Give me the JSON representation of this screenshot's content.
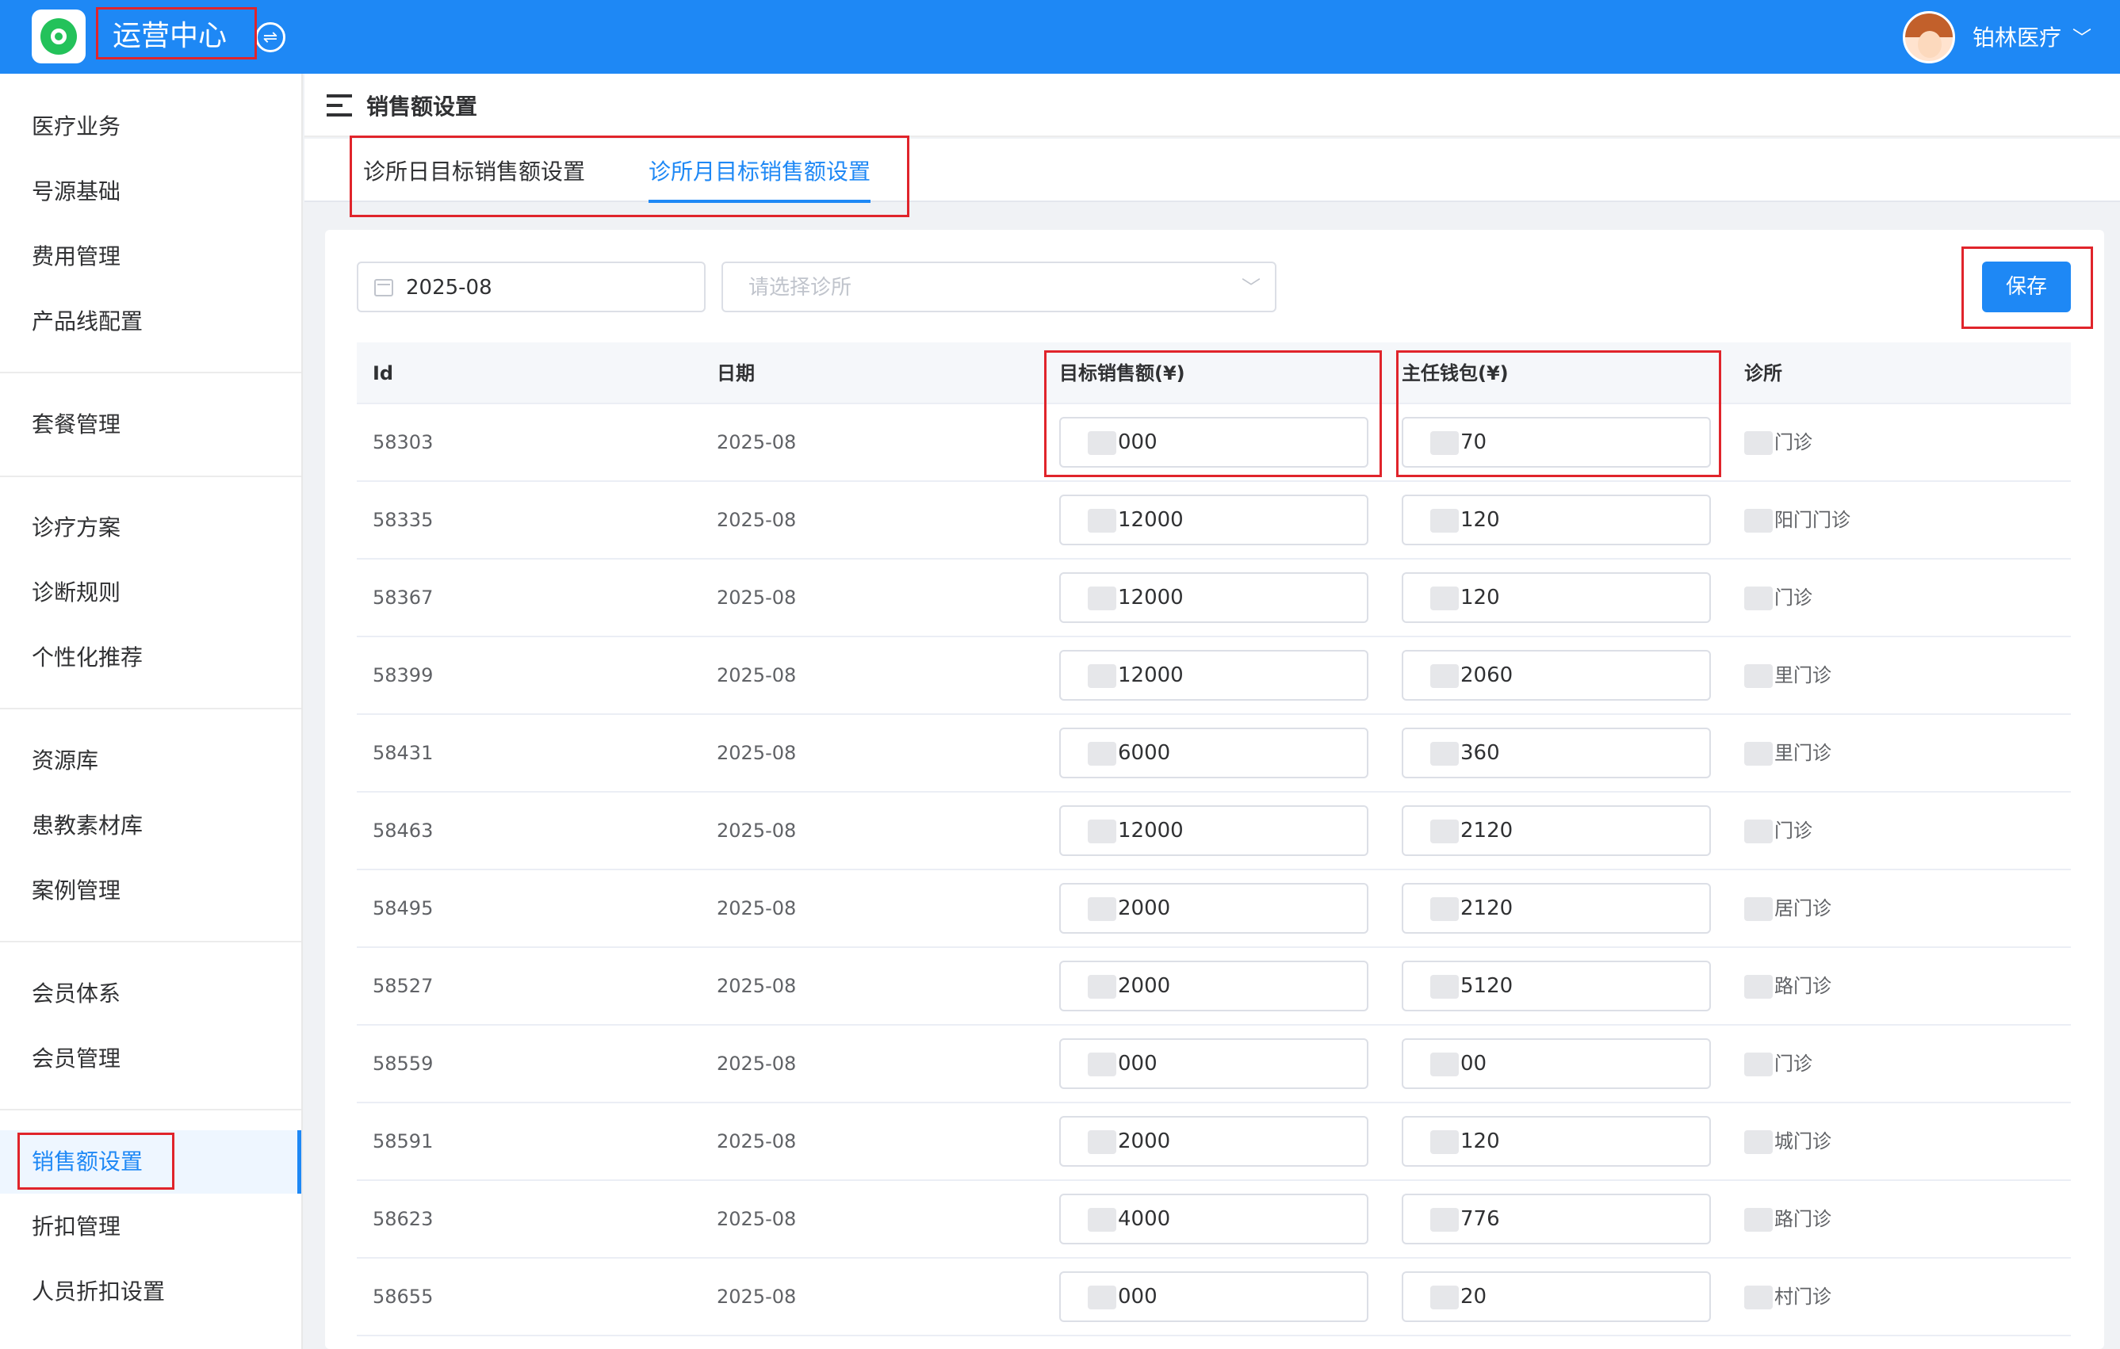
{
  "header": {
    "app_title": "运营中心",
    "user_name": "铂林医疗",
    "user_caret": "﹀",
    "brand_color": "#1e88f5"
  },
  "sidebar": {
    "items": [
      {
        "label": "医疗业务"
      },
      {
        "label": "号源基础"
      },
      {
        "label": "费用管理"
      },
      {
        "label": "产品线配置"
      },
      {
        "label": "套餐管理"
      },
      {
        "label": "诊疗方案"
      },
      {
        "label": "诊断规则"
      },
      {
        "label": "个性化推荐"
      },
      {
        "label": "资源库"
      },
      {
        "label": "患教素材库"
      },
      {
        "label": "案例管理"
      },
      {
        "label": "会员体系"
      },
      {
        "label": "会员管理"
      },
      {
        "label": "销售额设置",
        "active": true
      },
      {
        "label": "折扣管理"
      },
      {
        "label": "人员折扣设置"
      }
    ]
  },
  "page": {
    "title": "销售额设置"
  },
  "tabs": [
    {
      "label": "诊所日目标销售额设置",
      "active": false
    },
    {
      "label": "诊所月目标销售额设置",
      "active": true
    }
  ],
  "filters": {
    "month_value": "2025-08",
    "clinic_placeholder": "请选择诊所",
    "clinic_chevron": "﹀"
  },
  "actions": {
    "save_label": "保存"
  },
  "table": {
    "columns": [
      "Id",
      "日期",
      "目标销售额(¥)",
      "主任钱包(¥)",
      "诊所"
    ],
    "rows": [
      {
        "id": "58303",
        "date": "2025-08",
        "target": "000",
        "wallet": "70",
        "clinic": "门诊"
      },
      {
        "id": "58335",
        "date": "2025-08",
        "target": "12000",
        "wallet": "120",
        "clinic": "阳门门诊"
      },
      {
        "id": "58367",
        "date": "2025-08",
        "target": "12000",
        "wallet": "120",
        "clinic": "门诊"
      },
      {
        "id": "58399",
        "date": "2025-08",
        "target": "12000",
        "wallet": "2060",
        "clinic": "里门诊"
      },
      {
        "id": "58431",
        "date": "2025-08",
        "target": "6000",
        "wallet": "360",
        "clinic": "里门诊"
      },
      {
        "id": "58463",
        "date": "2025-08",
        "target": "12000",
        "wallet": "2120",
        "clinic": "门诊"
      },
      {
        "id": "58495",
        "date": "2025-08",
        "target": "2000",
        "wallet": "2120",
        "clinic": "居门诊"
      },
      {
        "id": "58527",
        "date": "2025-08",
        "target": "2000",
        "wallet": "5120",
        "clinic": "路门诊"
      },
      {
        "id": "58559",
        "date": "2025-08",
        "target": "000",
        "wallet": "00",
        "clinic": "门诊"
      },
      {
        "id": "58591",
        "date": "2025-08",
        "target": "2000",
        "wallet": "120",
        "clinic": "城门诊"
      },
      {
        "id": "58623",
        "date": "2025-08",
        "target": "4000",
        "wallet": "776",
        "clinic": "路门诊"
      },
      {
        "id": "58655",
        "date": "2025-08",
        "target": "000",
        "wallet": "20",
        "clinic": "村门诊"
      }
    ]
  }
}
